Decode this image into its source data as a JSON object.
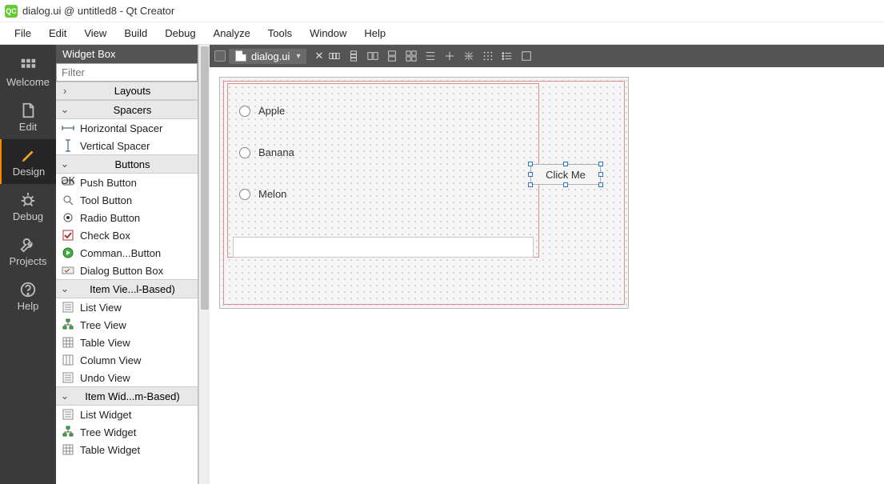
{
  "window": {
    "title": "dialog.ui @ untitled8 - Qt Creator"
  },
  "menubar": [
    "File",
    "Edit",
    "View",
    "Build",
    "Debug",
    "Analyze",
    "Tools",
    "Window",
    "Help"
  ],
  "modes": [
    {
      "key": "welcome",
      "label": "Welcome"
    },
    {
      "key": "edit",
      "label": "Edit"
    },
    {
      "key": "design",
      "label": "Design",
      "active": true
    },
    {
      "key": "debug",
      "label": "Debug"
    },
    {
      "key": "projects",
      "label": "Projects"
    },
    {
      "key": "help",
      "label": "Help"
    }
  ],
  "widgetbox": {
    "title": "Widget Box",
    "filter_placeholder": "Filter",
    "groups": [
      {
        "label": "Layouts",
        "collapsed": true
      },
      {
        "label": "Spacers",
        "collapsed": false,
        "items": [
          {
            "icon": "hspacer",
            "label": "Horizontal Spacer"
          },
          {
            "icon": "vspacer",
            "label": "Vertical Spacer"
          }
        ]
      },
      {
        "label": "Buttons",
        "collapsed": false,
        "items": [
          {
            "icon": "push",
            "label": "Push Button"
          },
          {
            "icon": "tool",
            "label": "Tool Button"
          },
          {
            "icon": "radio",
            "label": "Radio Button"
          },
          {
            "icon": "check",
            "label": "Check Box"
          },
          {
            "icon": "cmd",
            "label": "Comman...Button"
          },
          {
            "icon": "dlgbtn",
            "label": "Dialog Button Box"
          }
        ]
      },
      {
        "label": "Item Vie...l-Based)",
        "collapsed": false,
        "items": [
          {
            "icon": "list",
            "label": "List View"
          },
          {
            "icon": "tree",
            "label": "Tree View"
          },
          {
            "icon": "table",
            "label": "Table View"
          },
          {
            "icon": "column",
            "label": "Column View"
          },
          {
            "icon": "list",
            "label": "Undo View"
          }
        ]
      },
      {
        "label": "Item Wid...m-Based)",
        "collapsed": false,
        "items": [
          {
            "icon": "list",
            "label": "List Widget"
          },
          {
            "icon": "tree",
            "label": "Tree Widget"
          },
          {
            "icon": "table",
            "label": "Table Widget"
          }
        ]
      }
    ]
  },
  "tab": {
    "label": "dialog.ui"
  },
  "form": {
    "radios": [
      "Apple",
      "Banana",
      "Melon"
    ],
    "button_label": "Click Me"
  }
}
